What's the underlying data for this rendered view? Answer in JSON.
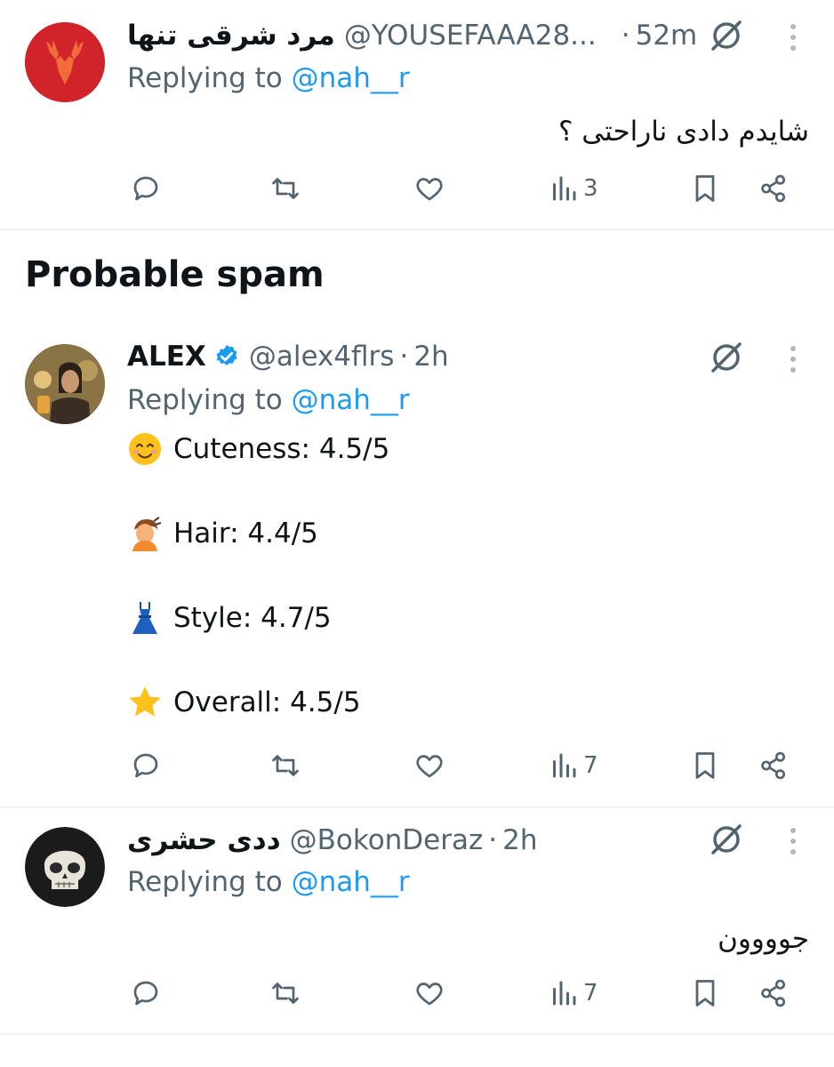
{
  "tweets": [
    {
      "name": "مرد شرقی تنها",
      "handle": "@YOUSEFAAA28...",
      "time": "52m",
      "replying_prefix": "Replying to",
      "replying_to": "@nah__r",
      "text": "شایدم دادی ناراحتی ؟",
      "views": "3",
      "avatar": "red-deer-avatar"
    },
    {
      "name": "ALEX",
      "verified": true,
      "handle": "@alex4flrs",
      "time": "2h",
      "replying_prefix": "Replying to",
      "replying_to": "@nah__r",
      "lines": [
        {
          "emoji": "smiling-face-emoji",
          "text": "Cuteness: 4.5/5"
        },
        {
          "emoji": "haircut-emoji",
          "text": "Hair: 4.4/5"
        },
        {
          "emoji": "dress-emoji",
          "text": "Style: 4.7/5"
        },
        {
          "emoji": "star-emoji",
          "text": "Overall: 4.5/5"
        }
      ],
      "views": "7",
      "avatar": "man-photo-avatar"
    },
    {
      "name": "ددی حشری",
      "handle": "@BokonDeraz",
      "time": "2h",
      "replying_prefix": "Replying to",
      "replying_to": "@nah__r",
      "text": "جوووون",
      "views": "7",
      "avatar": "skull-avatar"
    }
  ],
  "section_title": "Probable spam",
  "colors": {
    "accent": "#1d9bf0",
    "secondary_text": "#536471",
    "primary_text": "#0f1419",
    "divider": "#eff3f4"
  },
  "icons": [
    "reply-icon",
    "retweet-icon",
    "like-icon",
    "views-icon",
    "bookmark-icon",
    "share-icon",
    "grok-icon",
    "more-icon",
    "verified-badge-icon"
  ]
}
